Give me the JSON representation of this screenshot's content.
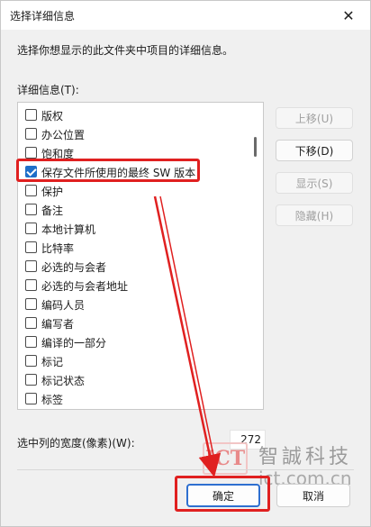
{
  "window": {
    "title": "选择详细信息",
    "close_icon": "✕"
  },
  "description": "选择你想显示的此文件夹中项目的详细信息。",
  "list": {
    "label": "详细信息(T):",
    "items": [
      {
        "label": "版权",
        "checked": false
      },
      {
        "label": "办公位置",
        "checked": false
      },
      {
        "label": "饱和度",
        "checked": false
      },
      {
        "label": "保存文件所使用的最终 SW 版本",
        "checked": true
      },
      {
        "label": "保护",
        "checked": false
      },
      {
        "label": "备注",
        "checked": false
      },
      {
        "label": "本地计算机",
        "checked": false
      },
      {
        "label": "比特率",
        "checked": false
      },
      {
        "label": "必选的与会者",
        "checked": false
      },
      {
        "label": "必选的与会者地址",
        "checked": false
      },
      {
        "label": "编码人员",
        "checked": false
      },
      {
        "label": "编写者",
        "checked": false
      },
      {
        "label": "编译的一部分",
        "checked": false
      },
      {
        "label": "标记",
        "checked": false
      },
      {
        "label": "标记状态",
        "checked": false
      },
      {
        "label": "标签",
        "checked": false
      }
    ]
  },
  "side_buttons": {
    "move_up": "上移(U)",
    "move_down": "下移(D)",
    "show": "显示(S)",
    "hide": "隐藏(H)"
  },
  "width": {
    "label": "选中列的宽度(像素)(W):",
    "value": "272"
  },
  "footer": {
    "ok": "确定",
    "cancel": "取消"
  },
  "watermark": {
    "logo": "ICT",
    "name_cn": "智誠科技",
    "url": "ict.com.cn"
  },
  "colors": {
    "highlight": "#e02020",
    "accent": "#1f6fc8"
  }
}
